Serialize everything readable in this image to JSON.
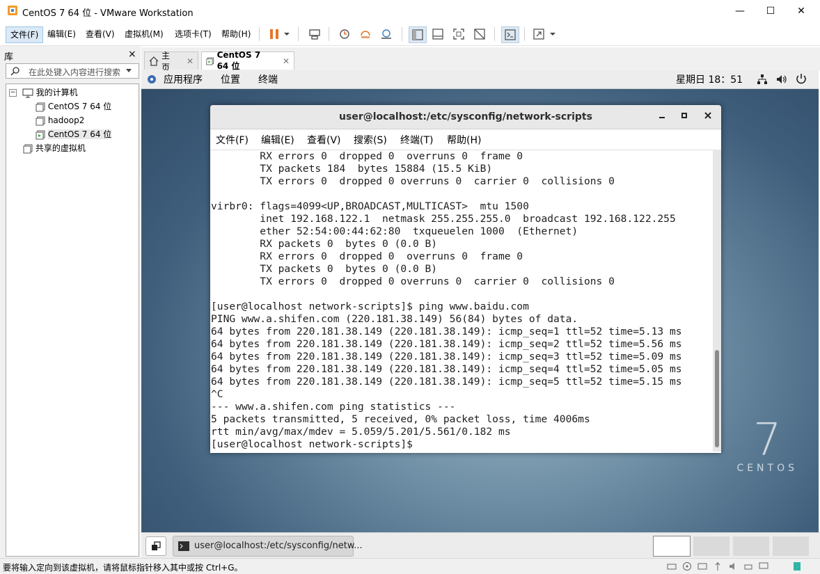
{
  "window": {
    "title": "CentOS 7 64 位 - VMware Workstation",
    "controls": {
      "minimize": "—",
      "maximize": "☐",
      "close": "✕"
    }
  },
  "menubar": {
    "items": [
      "文件(F)",
      "编辑(E)",
      "查看(V)",
      "虚拟机(M)",
      "选项卡(T)",
      "帮助(H)"
    ]
  },
  "library": {
    "title": "库",
    "close": "×",
    "search_placeholder": "在此处键入内容进行搜索",
    "tree": {
      "my_computer": "我的计算机",
      "vms": [
        "CentOS 7 64 位",
        "hadoop2",
        "CentOS 7 64 位"
      ],
      "shared": "共享的虚拟机"
    }
  },
  "tabs": [
    {
      "label": "主页",
      "close": "✕"
    },
    {
      "label": "CentOS 7 64 位",
      "close": "✕"
    }
  ],
  "guest": {
    "top_bar": {
      "applications": "应用程序",
      "places": "位置",
      "terminal": "终端",
      "clock": "星期日 18：51"
    },
    "logo": {
      "number": "7",
      "word": "CENTOS"
    },
    "terminal": {
      "title": "user@localhost:/etc/sysconfig/network-scripts",
      "menu": [
        "文件(F)",
        "编辑(E)",
        "查看(V)",
        "搜索(S)",
        "终端(T)",
        "帮助(H)"
      ],
      "lines": [
        "        RX errors 0  dropped 0  overruns 0  frame 0",
        "        TX packets 184  bytes 15884 (15.5 KiB)",
        "        TX errors 0  dropped 0 overruns 0  carrier 0  collisions 0",
        "",
        "virbr0: flags=4099<UP,BROADCAST,MULTICAST>  mtu 1500",
        "        inet 192.168.122.1  netmask 255.255.255.0  broadcast 192.168.122.255",
        "        ether 52:54:00:44:62:80  txqueuelen 1000  (Ethernet)",
        "        RX packets 0  bytes 0 (0.0 B)",
        "        RX errors 0  dropped 0  overruns 0  frame 0",
        "        TX packets 0  bytes 0 (0.0 B)",
        "        TX errors 0  dropped 0 overruns 0  carrier 0  collisions 0",
        "",
        "[user@localhost network-scripts]$ ping www.baidu.com",
        "PING www.a.shifen.com (220.181.38.149) 56(84) bytes of data.",
        "64 bytes from 220.181.38.149 (220.181.38.149): icmp_seq=1 ttl=52 time=5.13 ms",
        "64 bytes from 220.181.38.149 (220.181.38.149): icmp_seq=2 ttl=52 time=5.56 ms",
        "64 bytes from 220.181.38.149 (220.181.38.149): icmp_seq=3 ttl=52 time=5.09 ms",
        "64 bytes from 220.181.38.149 (220.181.38.149): icmp_seq=4 ttl=52 time=5.05 ms",
        "64 bytes from 220.181.38.149 (220.181.38.149): icmp_seq=5 ttl=52 time=5.15 ms",
        "^C",
        "--- www.a.shifen.com ping statistics ---",
        "5 packets transmitted, 5 received, 0% packet loss, time 4006ms",
        "rtt min/avg/max/mdev = 5.059/5.201/5.561/0.182 ms",
        "[user@localhost network-scripts]$ "
      ]
    },
    "taskbar": {
      "task_label": "user@localhost:/etc/sysconfig/netw..."
    }
  },
  "statusbar": {
    "message": "要将输入定向到该虚拟机，请将鼠标指针移入其中或按 Ctrl+G。"
  },
  "colors": {
    "accent": "#dbe9f6",
    "pause_orange": "#e8742a",
    "desktop_dark": "#2f4a66"
  }
}
